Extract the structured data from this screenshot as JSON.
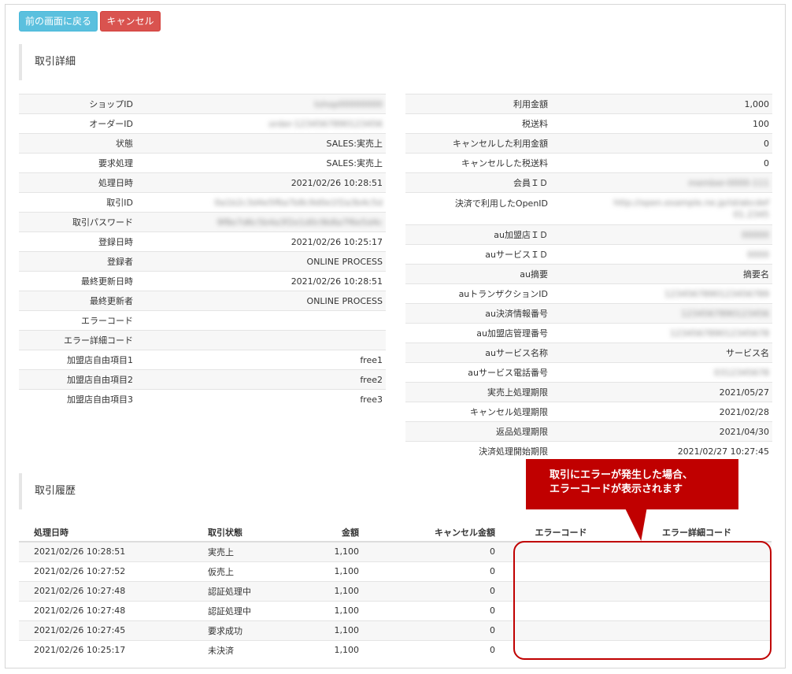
{
  "toolbar": {
    "back_label": "前の画面に戻る",
    "cancel_label": "キャンセル"
  },
  "detail": {
    "title": "取引詳細",
    "left": [
      {
        "label": "ショップID",
        "value": "tshop00000000",
        "blur": true
      },
      {
        "label": "オーダーID",
        "value": "order-1234567890123456",
        "blur": true
      },
      {
        "label": "状態",
        "value": "SALES:実売上"
      },
      {
        "label": "要求処理",
        "value": "SALES:実売上"
      },
      {
        "label": "処理日時",
        "value": "2021/02/26 10:28:51"
      },
      {
        "label": "取引ID",
        "value": "0a1b2c3d4e5f6a7b8c9d0e1f2a3b4c5d",
        "blur": true
      },
      {
        "label": "取引パスワード",
        "value": "9f8e7d6c5b4a3f2e1d0c9b8a7f6e5d4c",
        "blur": true
      },
      {
        "label": "登録日時",
        "value": "2021/02/26 10:25:17"
      },
      {
        "label": "登録者",
        "value": "ONLINE PROCESS"
      },
      {
        "label": "最終更新日時",
        "value": "2021/02/26 10:28:51"
      },
      {
        "label": "最終更新者",
        "value": "ONLINE PROCESS"
      },
      {
        "label": "エラーコード",
        "value": ""
      },
      {
        "label": "エラー詳細コード",
        "value": ""
      },
      {
        "label": "加盟店自由項目1",
        "value": "free1"
      },
      {
        "label": "加盟店自由項目2",
        "value": "free2"
      },
      {
        "label": "加盟店自由項目3",
        "value": "free3"
      }
    ],
    "right": [
      {
        "label": "利用金額",
        "value": "1,000"
      },
      {
        "label": "税送料",
        "value": "100"
      },
      {
        "label": "キャンセルした利用金額",
        "value": "0"
      },
      {
        "label": "キャンセルした税送料",
        "value": "0"
      },
      {
        "label": "会員ＩＤ",
        "value": "member-0000-111",
        "blur": true
      },
      {
        "label": "決済で利用したOpenID",
        "value": "http://open.example.ne.jp/id/abcdef",
        "value2": "01.2345",
        "blur": true,
        "tall": true
      },
      {
        "label": "au加盟店ＩＤ",
        "value": "00000",
        "blur": true
      },
      {
        "label": "auサービスＩＤ",
        "value": "0000",
        "blur": true
      },
      {
        "label": "au摘要",
        "value": "摘要名"
      },
      {
        "label": "auトランザクションID",
        "value": "1234567890123456789",
        "blur": true
      },
      {
        "label": "au決済情報番号",
        "value": "1234567890123456",
        "blur": true
      },
      {
        "label": "au加盟店管理番号",
        "value": "123456789012345678",
        "blur": true
      },
      {
        "label": "auサービス名称",
        "value": "サービス名"
      },
      {
        "label": "auサービス電話番号",
        "value": "0312345678",
        "blur": true
      },
      {
        "label": "実売上処理期限",
        "value": "2021/05/27"
      },
      {
        "label": "キャンセル処理期限",
        "value": "2021/02/28"
      },
      {
        "label": "返品処理期限",
        "value": "2021/04/30"
      },
      {
        "label": "決済処理開始期限",
        "value": "2021/02/27 10:27:45"
      }
    ]
  },
  "history": {
    "title": "取引履歴",
    "columns": [
      "処理日時",
      "取引状態",
      "金額",
      "キャンセル金額",
      "エラーコード",
      "エラー詳細コード"
    ],
    "rows": [
      [
        "2021/02/26 10:28:51",
        "実売上",
        "1,100",
        "0",
        "",
        ""
      ],
      [
        "2021/02/26 10:27:52",
        "仮売上",
        "1,100",
        "0",
        "",
        ""
      ],
      [
        "2021/02/26 10:27:48",
        "認証処理中",
        "1,100",
        "0",
        "",
        ""
      ],
      [
        "2021/02/26 10:27:48",
        "認証処理中",
        "1,100",
        "0",
        "",
        ""
      ],
      [
        "2021/02/26 10:27:45",
        "要求成功",
        "1,100",
        "0",
        "",
        ""
      ],
      [
        "2021/02/26 10:25:17",
        "未決済",
        "1,100",
        "0",
        "",
        ""
      ]
    ]
  },
  "callout": {
    "line1": "取引にエラーが発生した場合、",
    "line2": "エラーコードが表示されます",
    "color": "#c00000"
  }
}
